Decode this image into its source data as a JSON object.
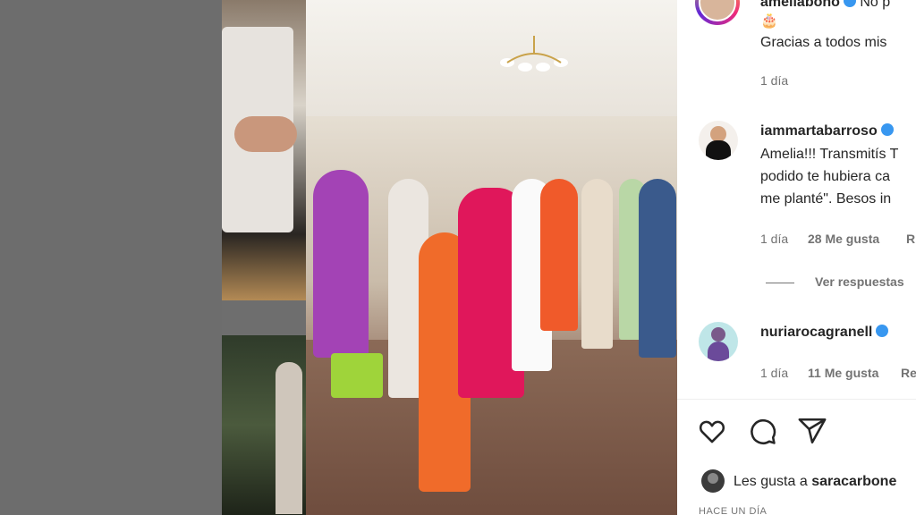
{
  "post_owner": {
    "username": "ameliabono",
    "caption_fragment": "No p"
  },
  "comments": [
    {
      "username": "ameliabono",
      "emoji": "🎂",
      "lines": [
        "Gracias a todos mis"
      ],
      "time": "1 día"
    },
    {
      "username": "iammartabarroso",
      "lines": [
        "Amelia!!! Transmitís T",
        "podido te hubiera ca",
        "me planté\". Besos in"
      ],
      "time": "1 día",
      "likes": "28 Me gusta",
      "reply": "R",
      "view_replies": "Ver respuestas"
    },
    {
      "username": "nuriarocagranell",
      "time": "1 día",
      "likes": "11 Me gusta",
      "reply": "Re"
    }
  ],
  "liked_by": {
    "prefix": "Les gusta a",
    "username": "saracarbone"
  },
  "post_time": "HACE UN DÍA",
  "colors": {
    "verified": "#3897f0",
    "text": "#262626",
    "muted": "#737373"
  },
  "icons": [
    "heart-icon",
    "comment-icon",
    "share-icon"
  ]
}
